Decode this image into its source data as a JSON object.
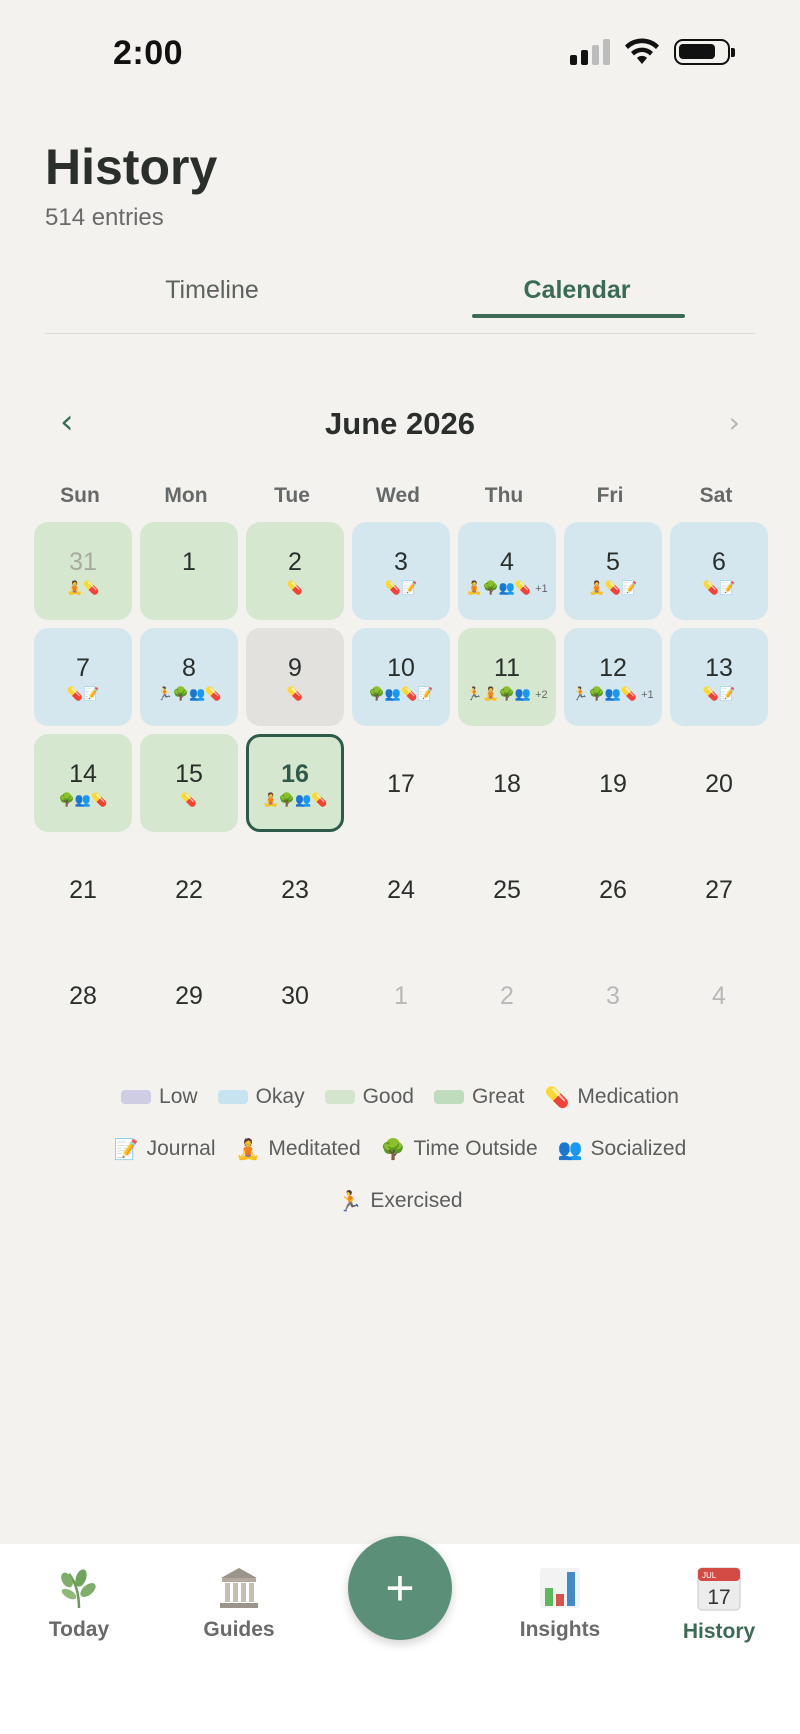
{
  "status_bar": {
    "time": "2:00"
  },
  "header": {
    "title": "History",
    "entries": "514 entries"
  },
  "tabs": [
    {
      "label": "Timeline",
      "active": false
    },
    {
      "label": "Calendar",
      "active": true
    }
  ],
  "calendar": {
    "month_title": "June 2026",
    "prev_icon": "chevron-left-icon",
    "next_icon": "chevron-right-icon",
    "weekdays": [
      "Sun",
      "Mon",
      "Tue",
      "Wed",
      "Thu",
      "Fri",
      "Sat"
    ],
    "days": [
      {
        "num": "31",
        "mood": "good",
        "icons": "🧘💊",
        "more": "",
        "other": true
      },
      {
        "num": "1",
        "mood": "good",
        "icons": "",
        "more": ""
      },
      {
        "num": "2",
        "mood": "good",
        "icons": "💊",
        "more": ""
      },
      {
        "num": "3",
        "mood": "okay",
        "icons": "💊📝",
        "more": ""
      },
      {
        "num": "4",
        "mood": "okay",
        "icons": "🧘🌳👥💊",
        "more": "+1"
      },
      {
        "num": "5",
        "mood": "okay",
        "icons": "🧘💊📝",
        "more": ""
      },
      {
        "num": "6",
        "mood": "okay",
        "icons": "💊📝",
        "more": ""
      },
      {
        "num": "7",
        "mood": "okay",
        "icons": "💊📝",
        "more": ""
      },
      {
        "num": "8",
        "mood": "okay",
        "icons": "🏃🌳👥💊",
        "more": ""
      },
      {
        "num": "9",
        "mood": "none",
        "icons": "💊",
        "more": ""
      },
      {
        "num": "10",
        "mood": "okay",
        "icons": "🌳👥💊📝",
        "more": ""
      },
      {
        "num": "11",
        "mood": "good",
        "icons": "🏃🧘🌳👥",
        "more": "+2"
      },
      {
        "num": "12",
        "mood": "okay",
        "icons": "🏃🌳👥💊",
        "more": "+1"
      },
      {
        "num": "13",
        "mood": "okay",
        "icons": "💊📝",
        "more": ""
      },
      {
        "num": "14",
        "mood": "good",
        "icons": "🌳👥💊",
        "more": ""
      },
      {
        "num": "15",
        "mood": "good",
        "icons": "💊",
        "more": ""
      },
      {
        "num": "16",
        "mood": "good",
        "icons": "🧘🌳👥💊",
        "more": "",
        "today": true
      },
      {
        "num": "17"
      },
      {
        "num": "18"
      },
      {
        "num": "19"
      },
      {
        "num": "20"
      },
      {
        "num": "21"
      },
      {
        "num": "22"
      },
      {
        "num": "23"
      },
      {
        "num": "24"
      },
      {
        "num": "25"
      },
      {
        "num": "26"
      },
      {
        "num": "27"
      },
      {
        "num": "28"
      },
      {
        "num": "29"
      },
      {
        "num": "30"
      },
      {
        "num": "1",
        "other": true
      },
      {
        "num": "2",
        "other": true
      },
      {
        "num": "3",
        "other": true
      },
      {
        "num": "4",
        "other": true
      }
    ]
  },
  "legend": {
    "rows": [
      [
        {
          "type": "swatch",
          "color": "#cfcde3",
          "label": "Low"
        },
        {
          "type": "swatch",
          "color": "#c6e3ef",
          "label": "Okay"
        },
        {
          "type": "swatch",
          "color": "#d3e6cd",
          "label": "Good"
        },
        {
          "type": "swatch",
          "color": "#bfdcbd",
          "label": "Great"
        },
        {
          "type": "icon",
          "icon": "💊",
          "label": "Medication"
        }
      ],
      [
        {
          "type": "icon",
          "icon": "📝",
          "label": "Journal"
        },
        {
          "type": "icon",
          "icon": "🧘",
          "label": "Meditated"
        },
        {
          "type": "icon",
          "icon": "🌳",
          "label": "Time Outside"
        },
        {
          "type": "icon",
          "icon": "👥",
          "label": "Socialized"
        }
      ],
      [
        {
          "type": "icon",
          "icon": "🏃",
          "label": "Exercised"
        }
      ]
    ]
  },
  "bottom_nav": {
    "items": [
      {
        "label": "Today",
        "icon": "🌿",
        "name": "today"
      },
      {
        "label": "Guides",
        "icon": "🏛",
        "name": "guides"
      },
      {
        "label": "Insights",
        "icon": "📊",
        "name": "insights"
      },
      {
        "label": "History",
        "icon": "📅",
        "name": "history",
        "active": true
      }
    ],
    "fab_label": "+"
  },
  "colors": {
    "accent": "#3c6b55",
    "fab": "#5c8f77"
  }
}
